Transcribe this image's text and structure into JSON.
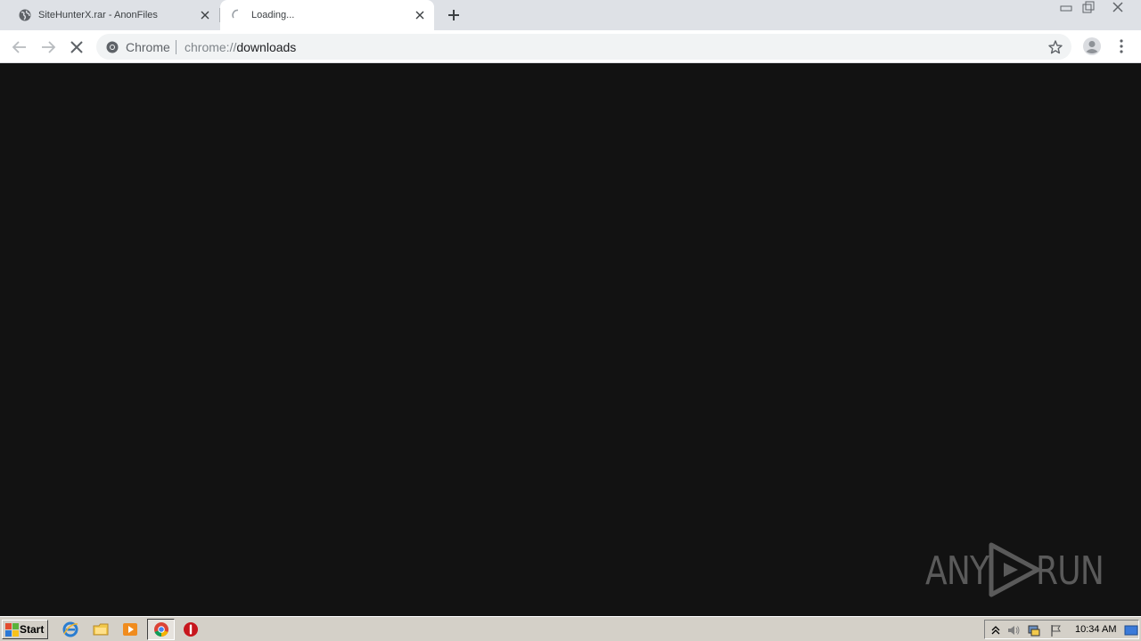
{
  "browser": {
    "tabs": [
      {
        "title": "SiteHunterX.rar - AnonFiles",
        "active": false
      },
      {
        "title": "Loading...",
        "active": true
      }
    ],
    "omnibox": {
      "site_label": "Chrome",
      "url_scheme": "chrome://",
      "url_path": "downloads"
    }
  },
  "watermark": {
    "left_text": "ANY",
    "right_text": "RUN"
  },
  "taskbar": {
    "start_label": "Start",
    "clock": "10:34 AM"
  },
  "colors": {
    "content_bg": "#121212",
    "tabstrip_bg": "#dee1e6",
    "taskbar_bg": "#d4d0c8",
    "watermark": "#5a5a5a"
  },
  "icons": [
    "globe-icon",
    "loading-spinner-icon",
    "close-icon",
    "plus-icon",
    "minimize-icon",
    "restore-icon",
    "back-arrow-icon",
    "forward-arrow-icon",
    "stop-icon",
    "chrome-logo-icon",
    "star-icon",
    "profile-icon",
    "kebab-menu-icon",
    "windows-logo-icon",
    "internet-explorer-icon",
    "folder-icon",
    "media-player-icon",
    "chrome-icon",
    "stop-sign-icon",
    "chevron-up-icon",
    "speaker-icon",
    "network-icon",
    "flag-icon",
    "show-desktop-icon"
  ]
}
